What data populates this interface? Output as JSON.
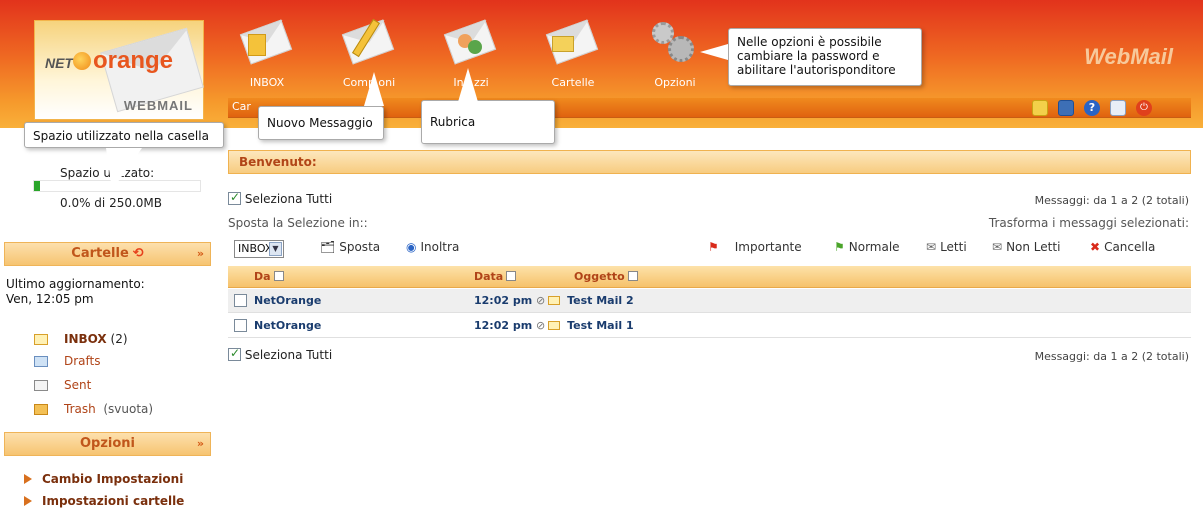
{
  "logo": {
    "prefix": "NET",
    "name": "orange",
    "sub": "WEBMAIL"
  },
  "brand": "WebMail",
  "nav": [
    {
      "label": "INBOX",
      "icon": "inbox-icon"
    },
    {
      "label": "Comp oni",
      "icon": "compose-pencil-icon"
    },
    {
      "label": "Ind zzi",
      "icon": "addressbook-icon"
    },
    {
      "label": "Cartelle",
      "icon": "folders-icon"
    },
    {
      "label": "Opzioni",
      "icon": "gears-icon"
    }
  ],
  "toolbar": {
    "crumb": "Car"
  },
  "tooltips": {
    "options": "Nelle opzioni è possibile cambiare la password e abilitare l'autorisponditore",
    "quota": "Spazio utilizzato nella casella",
    "compose": "Nuovo Messaggio",
    "addressbook": "Rubrica"
  },
  "sidebar": {
    "quota_label": "Spazio u    izzato:",
    "quota_percent": 0.0,
    "quota_text": "0.0% di 250.0MB",
    "folders_title": "Cartelle",
    "update_label": "Ultimo aggiornamento:",
    "update_time": "Ven, 12:05 pm",
    "folders": [
      {
        "name": "INBOX",
        "count": "(2)"
      },
      {
        "name": "Drafts"
      },
      {
        "name": "Sent"
      },
      {
        "name": "Trash",
        "action": "(svuota)"
      }
    ],
    "options_title": "Opzioni",
    "options_links": [
      "Cambio Impostazioni",
      "Impostazioni cartelle"
    ]
  },
  "main": {
    "welcome": "Benvenuto:",
    "select_all": "Seleziona Tutti",
    "messages_count": "Messaggi: da 1 a 2 (2 totali)",
    "move_label": "Sposta la Selezione in::",
    "transform_label": "Trasforma i messaggi selezionati:",
    "move_select_value": "INBOX",
    "actions": {
      "move": "Sposta",
      "forward": "Inoltra",
      "important": "Importante",
      "normal": "Normale",
      "read": "Letti",
      "unread": "Non Letti",
      "delete": "Cancella"
    },
    "columns": {
      "from": "Da",
      "date": "Data",
      "subject": "Oggetto"
    },
    "messages": [
      {
        "from": "NetOrange",
        "date": "12:02 pm",
        "subject": "Test Mail 2"
      },
      {
        "from": "NetOrange",
        "date": "12:02 pm",
        "subject": "Test Mail 1"
      }
    ]
  },
  "colors": {
    "header_top": "#e2331c",
    "header_bottom": "#f9b03a",
    "accent": "#c0561b",
    "link": "#1a3c6e"
  }
}
